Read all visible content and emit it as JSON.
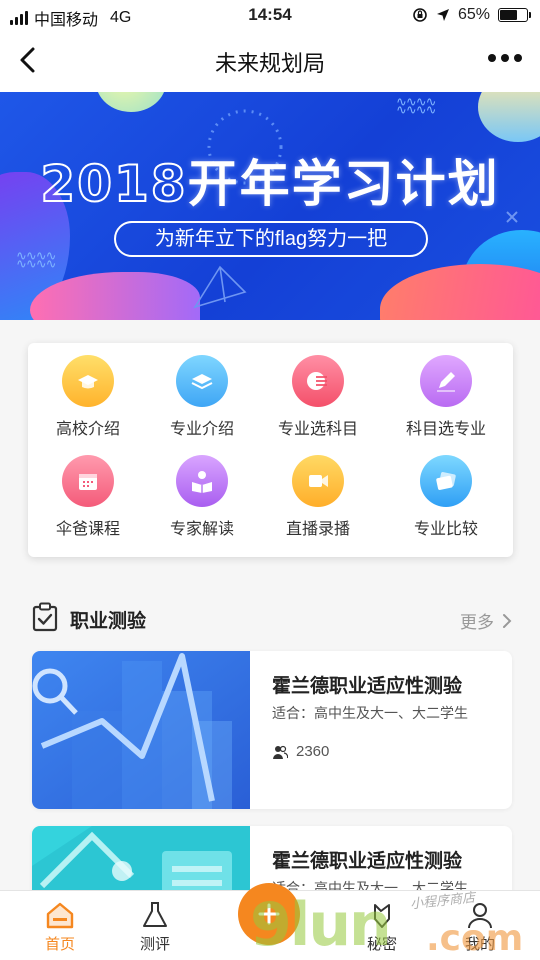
{
  "status_bar": {
    "carrier": "中国移动",
    "network": "4G",
    "time": "14:54",
    "battery": "65%",
    "battery_level": 0.65
  },
  "nav": {
    "title": "未来规划局",
    "back_icon": "chevron-left-icon",
    "more_icon": "more-dots-icon"
  },
  "banner": {
    "title_year": "2018",
    "title_rest": "开年学习计划",
    "subtitle": "为新年立下的flag努力一把"
  },
  "features": [
    {
      "label": "高校介绍",
      "icon": "graduation-cap-icon",
      "color_from": "#ffdf6a",
      "color_to": "#ffb32c"
    },
    {
      "label": "专业介绍",
      "icon": "layers-icon",
      "color_from": "#7fd6ff",
      "color_to": "#3fa6f5"
    },
    {
      "label": "专业选科目",
      "icon": "list-bubble-icon",
      "color_from": "#ff8fa5",
      "color_to": "#f4506a"
    },
    {
      "label": "科目选专业",
      "icon": "pencil-icon",
      "color_from": "#e0a8ff",
      "color_to": "#b96bf2"
    },
    {
      "label": "伞爸课程",
      "icon": "calendar-icon",
      "color_from": "#ff9aae",
      "color_to": "#f45b7a"
    },
    {
      "label": "专家解读",
      "icon": "reading-person-icon",
      "color_from": "#d9a5ff",
      "color_to": "#a95ef0"
    },
    {
      "label": "直播录播",
      "icon": "video-camera-icon",
      "color_from": "#ffd964",
      "color_to": "#ffae2a"
    },
    {
      "label": "专业比较",
      "icon": "compare-cards-icon",
      "color_from": "#7ed8ff",
      "color_to": "#2f9ff5"
    }
  ],
  "section": {
    "title": "职业测验",
    "more": "更多"
  },
  "tests": [
    {
      "title": "霍兰德职业适应性测验",
      "audience": "适合：高中生及大一、大二学生",
      "count": "2360"
    },
    {
      "title": "霍兰德职业适应性测验",
      "audience": "适合：高中生及大一、大二学生"
    }
  ],
  "tabs": [
    {
      "label": "首页",
      "icon": "home-icon"
    },
    {
      "label": "测评",
      "icon": "flask-icon"
    },
    {
      "label": "秘密",
      "icon": "secret-icon"
    },
    {
      "label": "我的",
      "icon": "user-icon"
    }
  ],
  "watermark": {
    "big": "9lun",
    "com": ".com",
    "small": "小程序商店"
  },
  "colors": {
    "accent": "#f5871f",
    "banner_blue": "#1a4fe0"
  }
}
